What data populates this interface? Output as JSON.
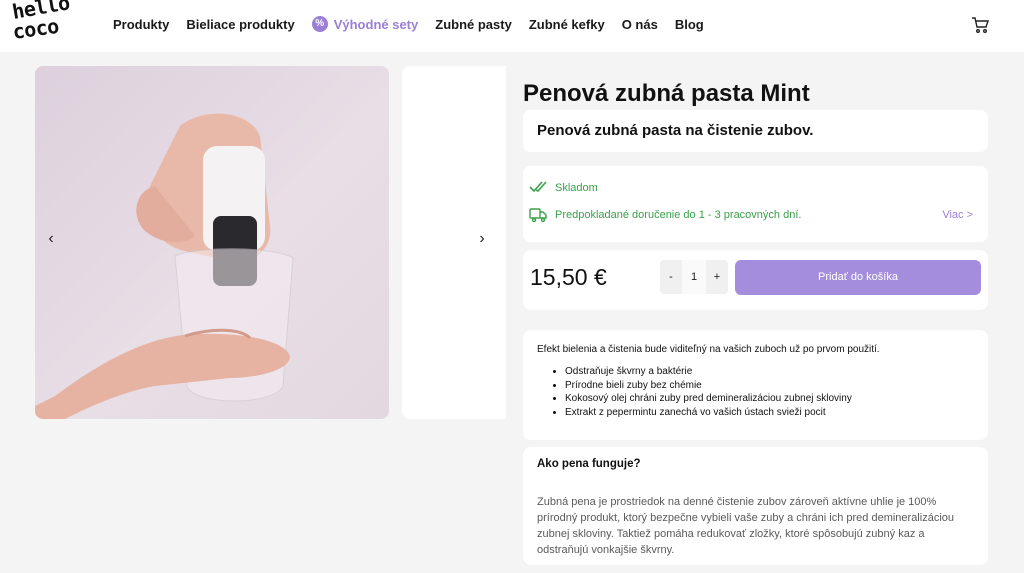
{
  "brand": {
    "logo_line1": "hello",
    "logo_line2": "coco"
  },
  "nav": {
    "items": [
      {
        "label": "Produkty"
      },
      {
        "label": "Bieliace produkty"
      },
      {
        "label": "Výhodné sety",
        "icon": "percent-badge-icon",
        "accent": "#9b7fd6"
      },
      {
        "label": "Zubné pasty"
      },
      {
        "label": "Zubné kefky"
      },
      {
        "label": "O nás"
      },
      {
        "label": "Blog"
      }
    ],
    "cart_icon": "cart-icon"
  },
  "gallery": {
    "prev_arrow": "‹",
    "next_arrow": "›"
  },
  "product": {
    "title": "Penová zubná pasta Mint",
    "subtitle": "Penová zubná pasta na čistenie zubov.",
    "stock_label": "Skladom",
    "delivery_label": "Predpokladané doručenie do 1 - 3 pracovných dní.",
    "more_link": "Viac >",
    "price": "15,50 €",
    "quantity": "1",
    "qty_minus": "-",
    "qty_plus": "+",
    "add_to_cart": "Pridať do košíka"
  },
  "description": {
    "intro": "Efekt bielenia a čistenia bude viditeľný na vašich zuboch už po prvom použití.",
    "bullets": [
      "Odstraňuje škvrny a baktérie",
      "Prírodne bieli zuby bez chémie",
      "Kokosový olej chráni zuby pred demineralizáciou zubnej skloviny",
      "Extrakt z pepermintu zanechá vo vašich ústach svieži pocit"
    ]
  },
  "how": {
    "title": "Ako pena funguje?",
    "text": "Zubná pena je prostriedok na denné čistenie zubov zároveň aktívne uhlie je 100% prírodný produkt, ktorý bezpečne vybieli vaše zuby a chráni ich pred demineralizáciou zubnej skloviny. Taktiež pomáha redukovať zložky, ktoré spôsobujú zubný kaz a odstraňujú vonkajšie škvrny."
  },
  "colors": {
    "accent": "#9b7fd6",
    "button": "#a58ddd",
    "stock_green": "#3aa04a"
  }
}
